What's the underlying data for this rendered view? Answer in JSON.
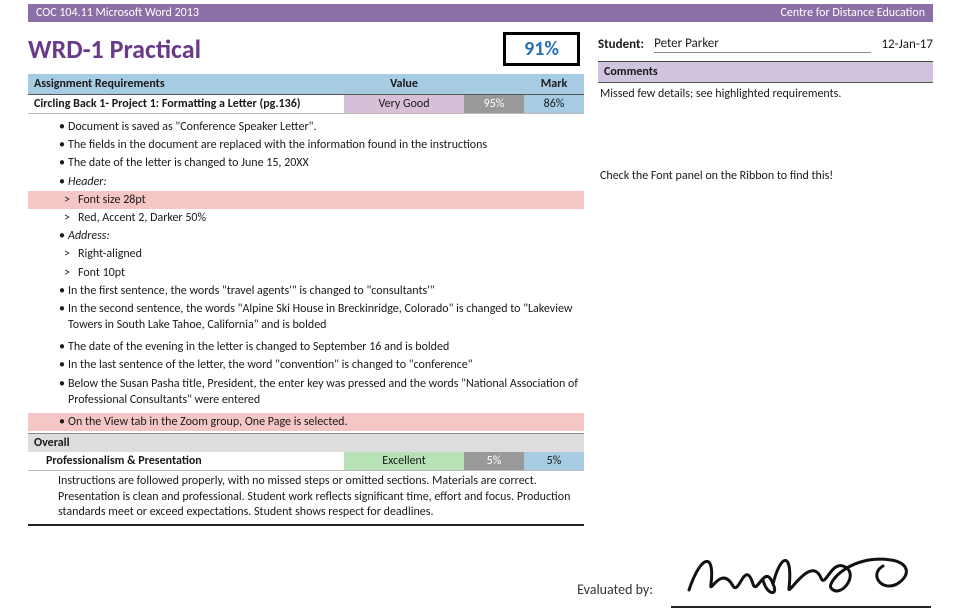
{
  "topbar": {
    "left": "COC 104.11 Microsoft Word 2013",
    "right": "Centre for Distance Education"
  },
  "title": "WRD-1 Practical",
  "overall_score": "91%",
  "student": {
    "label": "Student:",
    "name": "Peter Parker",
    "date": "12-Jan-17"
  },
  "headers": {
    "req": "Assignment Requirements",
    "value": "Value",
    "mark": "Mark"
  },
  "section": {
    "title": "Circling Back 1- Project 1: Formatting a  Letter (pg.136)",
    "rating": "Very Good",
    "pct": "95%",
    "mark": "86%"
  },
  "bullets": {
    "b1": "Document is saved as \"Conference Speaker Letter\".",
    "b2": "The fields in the document are replaced with the information found in the instructions",
    "b3": "The date of the letter is changed to June 15, 20XX",
    "b4": "Header:",
    "b4a": "Font size 28pt",
    "b4b": "Red, Accent 2, Darker 50%",
    "b5": "Address:",
    "b5a": "Right-aligned",
    "b5b": "Font 10pt",
    "b6": "In the first sentence, the words \"travel agents'\" is changed to \"consultants'\"",
    "b7": "In the second sentence, the words \"Alpine Ski House in Breckinridge, Colorado\" is changed to \"Lakeview Towers in South Lake Tahoe, California\" and is bolded",
    "b8": "The date of the evening in the letter is changed to September 16 and is bolded",
    "b9": "In the last sentence of the letter, the word \"convention\" is changed to \"conference\"",
    "b10": "Below the Susan Pasha title, President, the enter key was pressed and the words \"National Association of Professional Consultants\" were entered",
    "b11": "On the View tab in the Zoom group, One Page is selected."
  },
  "overall_hdr": "Overall",
  "prof": {
    "title": "Professionalism & Presentation",
    "rating": "Excellent",
    "pct": "5%",
    "mark": "5%",
    "desc": "Instructions are followed properly, with no missed steps or omitted sections. Materials are correct. Presentation is clean and professional. Student work reflects significant time, effort and focus.  Production standards meet or exceed expectations. Student shows respect for deadlines."
  },
  "comments": {
    "hdr": "Comments",
    "c1": "Missed few details; see highlighted requirements.",
    "c2": "Check the Font panel on the Ribbon to find this!"
  },
  "eval_label": "Evaluated by:"
}
